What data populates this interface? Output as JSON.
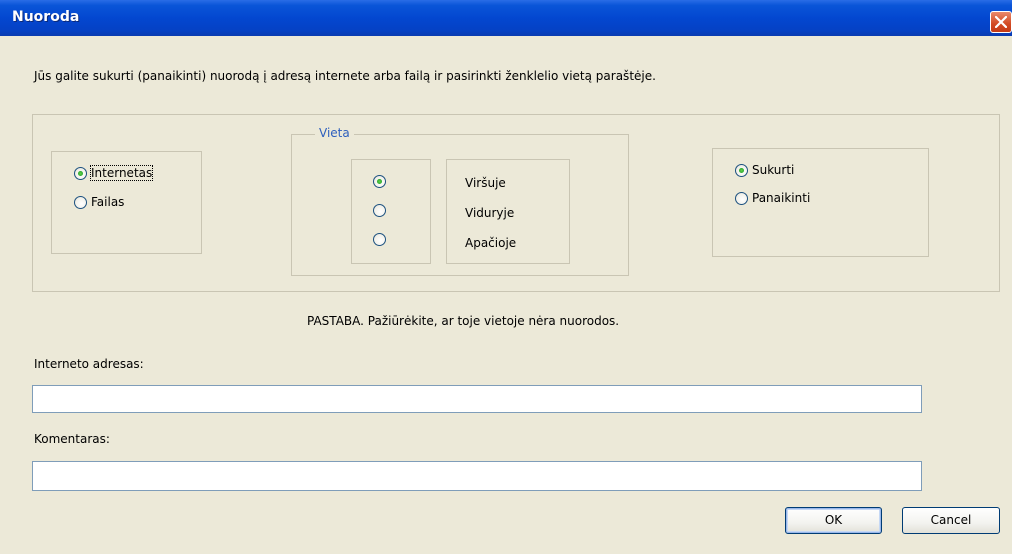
{
  "window": {
    "title": "Nuoroda"
  },
  "description": "Jūs galite sukurti (panaikinti)  nuorodą į adresą internete arba failą ir pasirinkti ženklelio vietą paraštėje.",
  "target": {
    "options": [
      {
        "label": "Internetas",
        "checked": true
      },
      {
        "label": "Failas",
        "checked": false
      }
    ]
  },
  "position": {
    "legend": "Vieta",
    "options": [
      {
        "label": "Viršuje",
        "checked": true
      },
      {
        "label": "Viduryje",
        "checked": false
      },
      {
        "label": "Apačioje",
        "checked": false
      }
    ]
  },
  "action": {
    "options": [
      {
        "label": "Sukurti",
        "checked": true
      },
      {
        "label": "Panaikinti",
        "checked": false
      }
    ]
  },
  "note": "PASTABA. Pažiūrėkite, ar toje vietoje nėra nuorodos.",
  "url": {
    "label": "Interneto adresas:",
    "value": ""
  },
  "comment": {
    "label": "Komentaras:",
    "value": ""
  },
  "buttons": {
    "ok": "OK",
    "cancel": "Cancel"
  },
  "colors": {
    "titlebar": "#0347d0",
    "dialog": "#ece9d8",
    "legend": "#2d5fbd",
    "radio_dot": "#21a12a"
  }
}
